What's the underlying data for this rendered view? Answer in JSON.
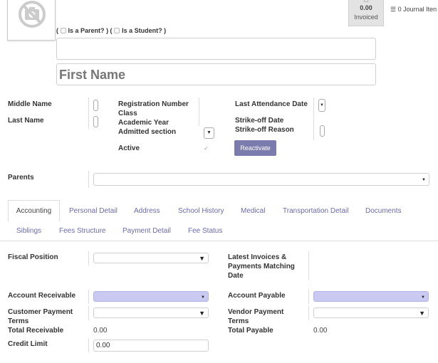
{
  "header": {
    "invoiced_amount": "0.00",
    "invoiced_label": "Invoiced",
    "journal_items": "0 Journal Iten"
  },
  "flags": {
    "parent_label": "Is a Parent?",
    "student_label": "Is a Student?"
  },
  "name": {
    "first_name_placeholder": "First Name"
  },
  "left_labels": {
    "middle_name": "Middle Name",
    "last_name": "Last Name"
  },
  "mid_labels": {
    "registration_number": "Registration Number",
    "class": "Class",
    "academic_year": "Academic Year",
    "admitted_section": "Admitted section",
    "active": "Active"
  },
  "right_labels": {
    "last_attendance": "Last Attendance Date",
    "strike_off_date": "Strike-off Date",
    "strike_off_reason": "Strike-off Reason"
  },
  "reactivate_button": "Reactivate",
  "parents_label": "Parents",
  "tabs": [
    "Accounting",
    "Personal Detail",
    "Address",
    "School History",
    "Medical",
    "Transportation Detail",
    "Documents",
    "Siblings",
    "Fees Structure",
    "Payment Detail",
    "Fee Status"
  ],
  "accounting": {
    "fiscal_position": "Fiscal Position",
    "latest_invoices_1": "Latest Invoices &",
    "latest_invoices_2": "Payments Matching",
    "latest_invoices_3": "Date",
    "account_receivable": "Account Receivable",
    "account_payable": "Account Payable",
    "customer_terms_1": "Customer Payment",
    "customer_terms_2": "Terms",
    "vendor_terms_1": "Vendor Payment",
    "vendor_terms_2": "Terms",
    "total_receivable": "Total Receivable",
    "total_receivable_value": "0.00",
    "total_payable": "Total Payable",
    "total_payable_value": "0.00",
    "credit_limit": "Credit Limit",
    "credit_limit_value": "0.00"
  },
  "colors": {
    "accent": "#7c7bad",
    "highlight_field": "#c9c9f2",
    "tab_link": "#6a6ab0"
  }
}
